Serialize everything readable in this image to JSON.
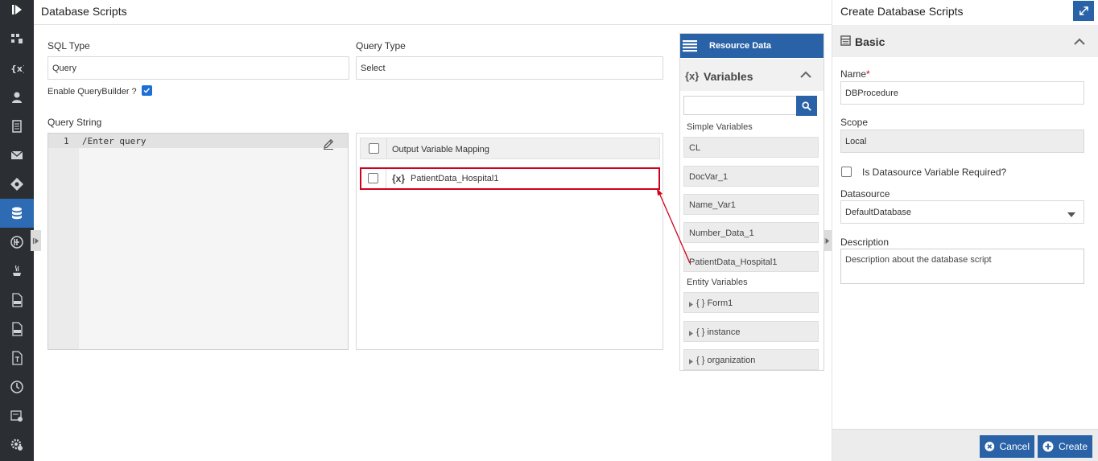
{
  "colors": {
    "rail_bg": "#2b2f33",
    "accent": "#2a62a8",
    "highlight_border": "#d0021b",
    "required": "#d0021b"
  },
  "rail": {
    "items": [
      {
        "name": "collapse-toggle-icon"
      },
      {
        "name": "process-map-icon"
      },
      {
        "name": "variables-icon"
      },
      {
        "name": "user-icon"
      },
      {
        "name": "document-icon"
      },
      {
        "name": "mail-icon"
      },
      {
        "name": "decision-icon"
      },
      {
        "name": "database-icon",
        "active": true
      },
      {
        "name": "integration-icon"
      },
      {
        "name": "java-icon"
      },
      {
        "name": "html-file-icon"
      },
      {
        "name": "css-file-icon"
      },
      {
        "name": "template-icon"
      },
      {
        "name": "clock-icon"
      },
      {
        "name": "form-settings-icon"
      },
      {
        "name": "settings-icon"
      }
    ]
  },
  "main": {
    "title": "Database Scripts",
    "sql_type": {
      "label": "SQL Type",
      "value": "Query"
    },
    "query_type": {
      "label": "Query Type",
      "value": "Select"
    },
    "enable_querybuilder": {
      "label": "Enable QueryBuilder ?",
      "checked": true
    },
    "query_string": {
      "label": "Query String",
      "line_number": "1",
      "code": "/Enter query"
    },
    "output_mapping": {
      "header": "Output Variable Mapping",
      "rows": [
        {
          "badge": "{x}",
          "name": "PatientData_Hospital1"
        }
      ]
    }
  },
  "resource": {
    "title": "Resource Data",
    "variables_title": "Variables",
    "variables_badge": "{x}",
    "search_placeholder": "",
    "simple_label": "Simple Variables",
    "simple_vars": [
      "CL",
      "DocVar_1",
      "Name_Var1",
      "Number_Data_1",
      "PatientData_Hospital1"
    ],
    "entity_label": "Entity Variables",
    "entity_vars": [
      "{ } Form1",
      "{ } instance",
      "{ } organization"
    ]
  },
  "panel": {
    "title": "Create Database Scripts",
    "section": "Basic",
    "name_label": "Name",
    "name_required": "*",
    "name_value": "DBProcedure",
    "scope_label": "Scope",
    "scope_value": "Local",
    "ds_required_label": "Is Datasource Variable Required?",
    "datasource_label": "Datasource",
    "datasource_value": "DefaultDatabase",
    "description_label": "Description",
    "description_value": "Description about the database script",
    "cancel_label": "Cancel",
    "create_label": "Create"
  }
}
